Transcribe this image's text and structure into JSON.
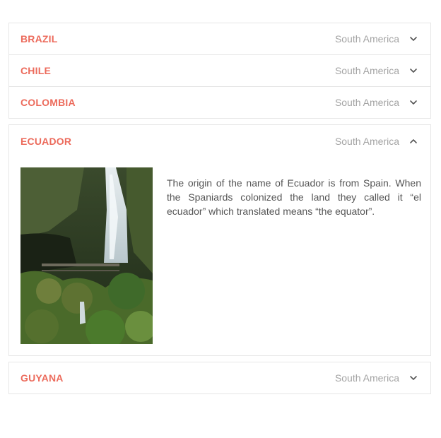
{
  "items": [
    {
      "name": "BRAZIL",
      "region": "South America",
      "expanded": false
    },
    {
      "name": "CHILE",
      "region": "South America",
      "expanded": false
    },
    {
      "name": "COLOMBIA",
      "region": "South America",
      "expanded": false
    },
    {
      "name": "ECUADOR",
      "region": "South America",
      "expanded": true,
      "description": "The origin of the name of Ecuador is from Spain. When the Spaniards colonized the land they called it “el ecuador” which translated means “the equator”."
    },
    {
      "name": "GUYANA",
      "region": "South America",
      "expanded": false
    }
  ],
  "colors": {
    "accent": "#ec6b5c",
    "muted": "#a3a3a3",
    "border": "#e6e6e6",
    "text": "#555555"
  },
  "icons": {
    "collapsed": "chevron-down-icon",
    "expanded": "chevron-up-icon"
  }
}
